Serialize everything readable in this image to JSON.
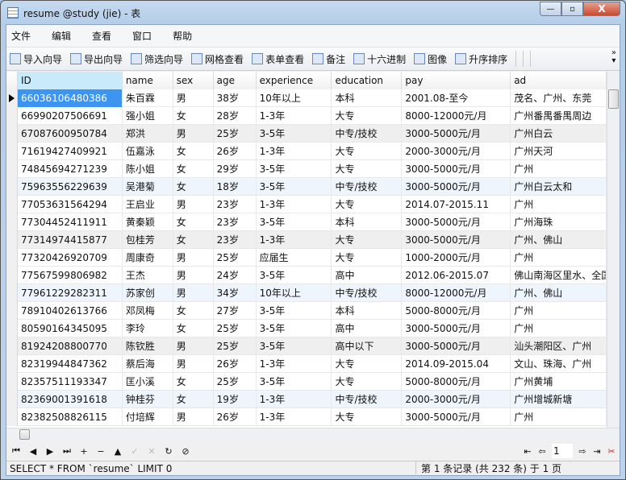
{
  "window": {
    "title": "resume @study (jie) - 表",
    "min": "—",
    "max": "▫",
    "close": "X"
  },
  "menu": [
    "文件",
    "编辑",
    "查看",
    "窗口",
    "帮助"
  ],
  "toolbar": [
    {
      "label": "导入向导",
      "icon": "import-wizard-icon"
    },
    {
      "label": "导出向导",
      "icon": "export-wizard-icon"
    },
    {
      "label": "筛选向导",
      "icon": "filter-icon"
    },
    {
      "label": "网格查看",
      "icon": "grid-view-icon"
    },
    {
      "label": "表单查看",
      "icon": "form-view-icon"
    },
    {
      "label": "备注",
      "icon": "note-icon"
    },
    {
      "label": "十六进制",
      "icon": "hex-icon"
    },
    {
      "label": "图像",
      "icon": "image-icon"
    },
    {
      "label": "升序排序",
      "icon": "sort-ascending-icon"
    }
  ],
  "toolbar_more": "»",
  "columns": [
    "ID",
    "name",
    "sex",
    "age",
    "experience",
    "education",
    "pay",
    "ad"
  ],
  "rows": [
    [
      "66036106480386",
      "朱百霖",
      "男",
      "38岁",
      "10年以上",
      "本科",
      "2001.08-至今",
      "茂名、广州、东莞"
    ],
    [
      "66990207506691",
      "强小姐",
      "女",
      "28岁",
      "1-3年",
      "大专",
      "8000-12000元/月",
      "广州番禺番禺周边"
    ],
    [
      "67087600950784",
      "郑洪",
      "男",
      "25岁",
      "3-5年",
      "中专/技校",
      "3000-5000元/月",
      "广州白云"
    ],
    [
      "71619427409921",
      "伍嘉泳",
      "女",
      "26岁",
      "1-3年",
      "大专",
      "2000-3000元/月",
      "广州天河"
    ],
    [
      "74845694271239",
      "陈小姐",
      "女",
      "29岁",
      "3-5年",
      "大专",
      "3000-5000元/月",
      "广州"
    ],
    [
      "75963556229639",
      "吴港菊",
      "女",
      "18岁",
      "3-5年",
      "中专/技校",
      "3000-5000元/月",
      "广州白云太和"
    ],
    [
      "77053631564294",
      "王启业",
      "男",
      "23岁",
      "1-3年",
      "大专",
      "2014.07-2015.11",
      "广州"
    ],
    [
      "77304452411911",
      "黄秦颖",
      "女",
      "23岁",
      "3-5年",
      "本科",
      "3000-5000元/月",
      "广州海珠"
    ],
    [
      "77314974415877",
      "包桂芳",
      "女",
      "23岁",
      "1-3年",
      "大专",
      "3000-5000元/月",
      "广州、佛山"
    ],
    [
      "77320426920709",
      "周康奇",
      "男",
      "25岁",
      "应届生",
      "大专",
      "1000-2000元/月",
      "广州"
    ],
    [
      "77567599806982",
      "王杰",
      "男",
      "24岁",
      "3-5年",
      "高中",
      "2012.06-2015.07",
      "佛山南海区里水、全国"
    ],
    [
      "77961229282311",
      "苏家创",
      "男",
      "34岁",
      "10年以上",
      "中专/技校",
      "8000-12000元/月",
      "广州、佛山"
    ],
    [
      "78910402613766",
      "邓凤梅",
      "女",
      "27岁",
      "3-5年",
      "本科",
      "5000-8000元/月",
      "广州"
    ],
    [
      "80590164345095",
      "李玲",
      "女",
      "25岁",
      "3-5年",
      "高中",
      "3000-5000元/月",
      "广州"
    ],
    [
      "81924208800770",
      "陈钦胜",
      "男",
      "25岁",
      "3-5年",
      "高中以下",
      "3000-5000元/月",
      "汕头潮阳区、广州"
    ],
    [
      "82319944847362",
      "蔡后海",
      "男",
      "26岁",
      "1-3年",
      "大专",
      "2014.09-2015.04",
      "文山、珠海、广州"
    ],
    [
      "82357511193347",
      "匡小溪",
      "女",
      "25岁",
      "3-5年",
      "大专",
      "5000-8000元/月",
      "广州黄埔"
    ],
    [
      "82369001391618",
      "钟桂芬",
      "女",
      "19岁",
      "1-3年",
      "中专/技校",
      "2000-3000元/月",
      "广州增城新塘"
    ],
    [
      "82382508826115",
      "付培辉",
      "男",
      "26岁",
      "1-3年",
      "大专",
      "3000-5000元/月",
      "广州"
    ]
  ],
  "row_styles": [
    "selected",
    "white",
    "gray",
    "white",
    "white",
    "blue",
    "white",
    "white",
    "gray",
    "white",
    "white",
    "blue",
    "white",
    "white",
    "gray",
    "white",
    "white",
    "blue",
    "white"
  ],
  "nav": {
    "buttons": [
      {
        "icon": "first-record-icon",
        "glyph": "⏮"
      },
      {
        "icon": "prev-record-icon",
        "glyph": "◀"
      },
      {
        "icon": "next-record-icon",
        "glyph": "▶"
      },
      {
        "icon": "last-record-icon",
        "glyph": "⏭"
      },
      {
        "icon": "add-record-icon",
        "glyph": "+"
      },
      {
        "icon": "delete-record-icon",
        "glyph": "−"
      },
      {
        "icon": "up-icon",
        "glyph": "▲"
      },
      {
        "icon": "apply-icon",
        "glyph": "✓"
      },
      {
        "icon": "cancel-icon",
        "glyph": "✕"
      },
      {
        "icon": "refresh-icon",
        "glyph": "↻"
      },
      {
        "icon": "stop-icon",
        "glyph": "⊘"
      }
    ],
    "page": "1",
    "first_page": "⇤",
    "prev_page": "⇦",
    "next_page": "⇨",
    "last_page": "⇥",
    "settings": "✂"
  },
  "status": {
    "query": "SELECT * FROM `resume` LIMIT 0",
    "records": "第 1 条记录 (共 232 条) 于 1 页"
  }
}
